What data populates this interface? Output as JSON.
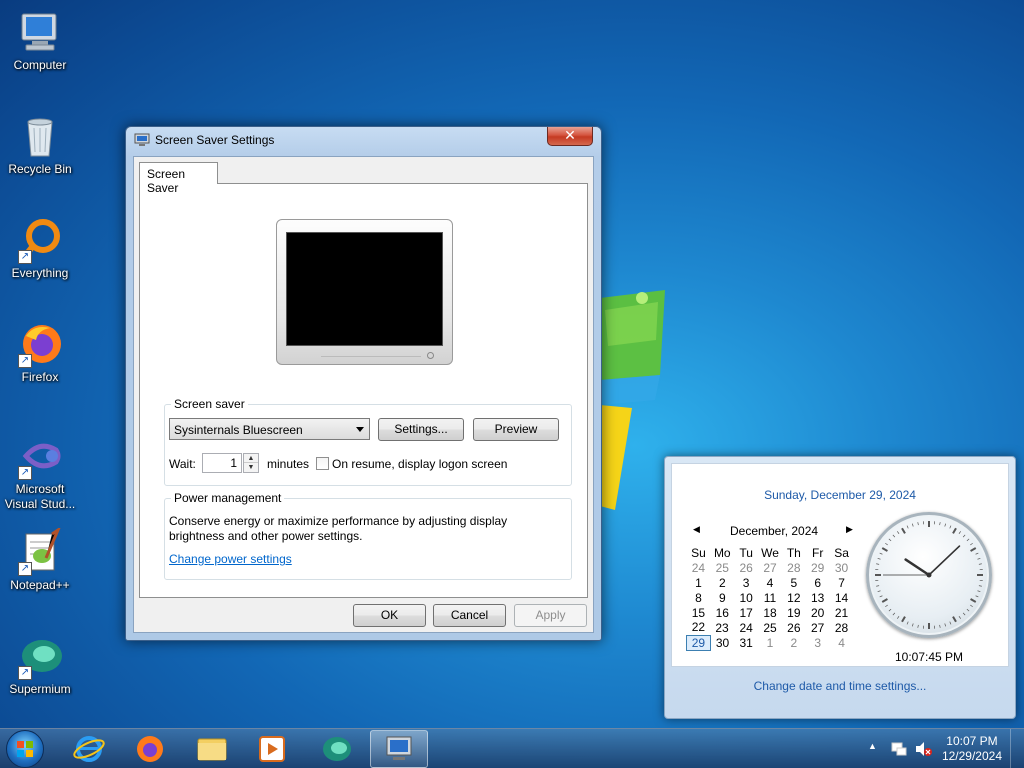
{
  "desktop": {
    "icons": [
      {
        "label": "Computer"
      },
      {
        "label": "Recycle Bin"
      },
      {
        "label": "Everything"
      },
      {
        "label": "Firefox"
      },
      {
        "label": "Microsoft Visual Stud..."
      },
      {
        "label": "Notepad++"
      },
      {
        "label": "Supermium"
      }
    ]
  },
  "dialog": {
    "title": "Screen Saver Settings",
    "close_label": "✕",
    "tab_label": "Screen Saver",
    "screen_saver_group": {
      "legend": "Screen saver",
      "selected": "Sysinternals Bluescreen",
      "settings_label": "Settings...",
      "preview_label": "Preview",
      "wait_label": "Wait:",
      "wait_value": "1",
      "minutes_label": "minutes",
      "resume_label": "On resume, display logon screen",
      "resume_checked": false
    },
    "power_group": {
      "legend": "Power management",
      "description": "Conserve energy or maximize performance by adjusting display brightness and other power settings.",
      "link": "Change power settings"
    },
    "ok_label": "OK",
    "cancel_label": "Cancel",
    "apply_label": "Apply"
  },
  "clock_flyout": {
    "long_date": "Sunday, December 29, 2024",
    "month_label": "December, 2024",
    "weekdays": [
      "Su",
      "Mo",
      "Tu",
      "We",
      "Th",
      "Fr",
      "Sa"
    ],
    "weeks": [
      [
        "24",
        "25",
        "26",
        "27",
        "28",
        "29",
        "30"
      ],
      [
        "1",
        "2",
        "3",
        "4",
        "5",
        "6",
        "7"
      ],
      [
        "8",
        "9",
        "10",
        "11",
        "12",
        "13",
        "14"
      ],
      [
        "15",
        "16",
        "17",
        "18",
        "19",
        "20",
        "21"
      ],
      [
        "22",
        "23",
        "24",
        "25",
        "26",
        "27",
        "28"
      ],
      [
        "29",
        "30",
        "31",
        "1",
        "2",
        "3",
        "4"
      ]
    ],
    "today": "29",
    "time": "10:07:45 PM",
    "settings_link": "Change date and time settings..."
  },
  "taskbar": {
    "time": "10:07 PM",
    "date": "12/29/2024"
  },
  "colors": {
    "accent_link": "#1e5aa8",
    "close_button": "#c53a22",
    "desktop_blue": "#1267b5"
  }
}
